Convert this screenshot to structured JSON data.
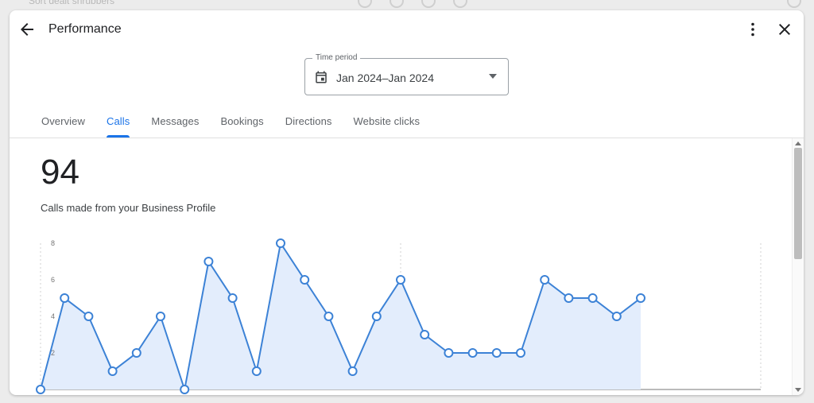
{
  "background": {
    "search_text": "Sort dealt shrubbers"
  },
  "header": {
    "title": "Performance"
  },
  "time_period": {
    "label": "Time period",
    "value": "Jan 2024–Jan 2024"
  },
  "tabs": [
    {
      "label": "Overview",
      "active": false
    },
    {
      "label": "Calls",
      "active": true
    },
    {
      "label": "Messages",
      "active": false
    },
    {
      "label": "Bookings",
      "active": false
    },
    {
      "label": "Directions",
      "active": false
    },
    {
      "label": "Website clicks",
      "active": false
    }
  ],
  "summary": {
    "total": "94",
    "description": "Calls made from your Business Profile"
  },
  "colors": {
    "accent": "#1a73e8",
    "line": "#3c82d6",
    "area": "#e3edfc"
  },
  "chart_data": {
    "type": "area",
    "title": "",
    "xlabel": "",
    "ylabel": "",
    "ylim": [
      0,
      8
    ],
    "yticks": [
      "8",
      "6",
      "4",
      "2"
    ],
    "values": [
      0,
      5,
      4,
      1,
      2,
      4,
      0,
      7,
      5,
      1,
      8,
      6,
      4,
      1,
      4,
      6,
      3,
      2,
      2,
      2,
      2,
      6,
      5,
      5,
      4,
      5
    ],
    "grid": "dashed vertical"
  }
}
